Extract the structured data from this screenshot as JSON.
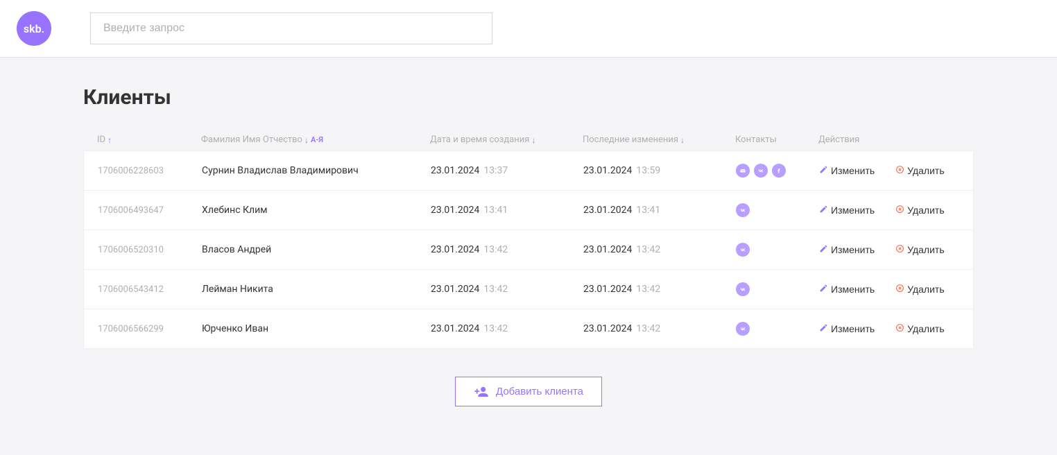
{
  "logo": "skb.",
  "search": {
    "placeholder": "Введите запрос"
  },
  "title": "Клиенты",
  "columns": {
    "id": "ID",
    "fio": "Фамилия Имя Отчество",
    "fio_sort": "А-Я",
    "created": "Дата и время создания",
    "updated": "Последние изменения",
    "contacts": "Контакты",
    "actions": "Действия"
  },
  "actions": {
    "edit": "Изменить",
    "delete": "Удалить",
    "add": "Добавить клиента"
  },
  "rows": [
    {
      "id": "1706006228603",
      "name": "Сурнин Владислав Владимирович",
      "created_date": "23.01.2024",
      "created_time": "13:37",
      "updated_date": "23.01.2024",
      "updated_time": "13:59",
      "contacts": [
        "mail",
        "vk",
        "fb"
      ]
    },
    {
      "id": "1706006493647",
      "name": "Хлебинс Клим",
      "created_date": "23.01.2024",
      "created_time": "13:41",
      "updated_date": "23.01.2024",
      "updated_time": "13:41",
      "contacts": [
        "vk"
      ]
    },
    {
      "id": "1706006520310",
      "name": "Власов Андрей",
      "created_date": "23.01.2024",
      "created_time": "13:42",
      "updated_date": "23.01.2024",
      "updated_time": "13:42",
      "contacts": [
        "vk"
      ]
    },
    {
      "id": "1706006543412",
      "name": "Лейман Никита",
      "created_date": "23.01.2024",
      "created_time": "13:42",
      "updated_date": "23.01.2024",
      "updated_time": "13:42",
      "contacts": [
        "vk"
      ]
    },
    {
      "id": "1706006566299",
      "name": "Юрченко Иван",
      "created_date": "23.01.2024",
      "created_time": "13:42",
      "updated_date": "23.01.2024",
      "updated_time": "13:42",
      "contacts": [
        "vk"
      ]
    }
  ]
}
